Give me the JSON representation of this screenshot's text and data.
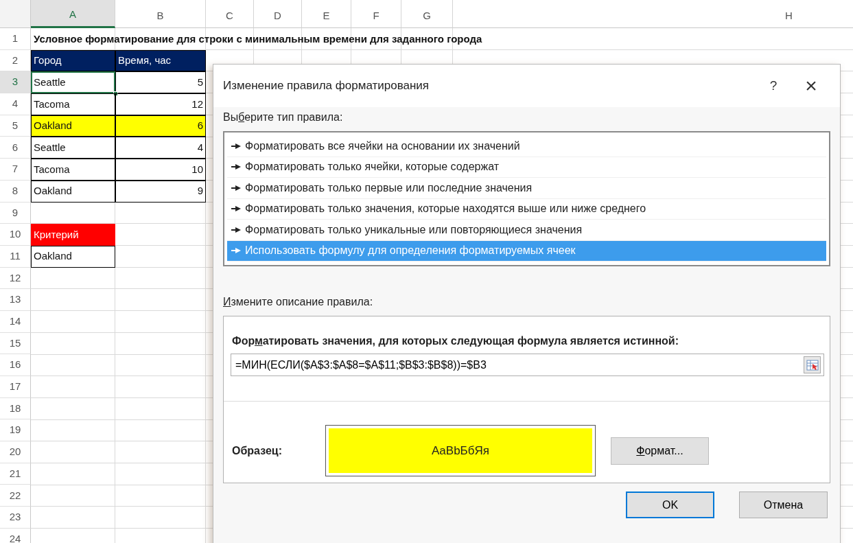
{
  "sheet": {
    "columns": [
      {
        "label": "A",
        "selected": true
      },
      {
        "label": "B",
        "selected": false
      },
      {
        "label": "C",
        "selected": false
      },
      {
        "label": "D",
        "selected": false
      },
      {
        "label": "E",
        "selected": false
      },
      {
        "label": "F",
        "selected": false
      },
      {
        "label": "G",
        "selected": false
      },
      {
        "label": "H",
        "selected": false
      }
    ],
    "rows": [
      {
        "label": "1",
        "selected": false,
        "cells": [
          {
            "kind": "title",
            "text": "Условное форматирование для строки с минимальным времени для заданного города"
          }
        ]
      },
      {
        "label": "2",
        "selected": false,
        "cells": [
          {
            "kind": "text",
            "text": "Город",
            "color": "#002060",
            "bordered": true,
            "selected": false
          },
          {
            "kind": "text",
            "text": "Время, час",
            "color": "#002060",
            "bordered": true,
            "selected": false
          }
        ]
      },
      {
        "label": "3",
        "selected": true,
        "cells": [
          {
            "kind": "text",
            "text": "Seattle",
            "bordered": true,
            "selected": true
          },
          {
            "kind": "number",
            "text": "5",
            "bordered": true,
            "selected": false
          }
        ]
      },
      {
        "label": "4",
        "selected": false,
        "cells": [
          {
            "kind": "text",
            "text": "Tacoma",
            "bordered": true,
            "selected": false
          },
          {
            "kind": "number",
            "text": "12",
            "bordered": true,
            "selected": false
          }
        ]
      },
      {
        "label": "5",
        "selected": false,
        "cells": [
          {
            "kind": "text",
            "text": "Oakland",
            "color": "#ffff00",
            "bordered": true,
            "selected": false
          },
          {
            "kind": "number",
            "text": "6",
            "color": "#ffff00",
            "bordered": true,
            "selected": false
          }
        ]
      },
      {
        "label": "6",
        "selected": false,
        "cells": [
          {
            "kind": "text",
            "text": "Seattle",
            "bordered": true,
            "selected": false
          },
          {
            "kind": "number",
            "text": "4",
            "bordered": true,
            "selected": false
          }
        ]
      },
      {
        "label": "7",
        "selected": false,
        "cells": [
          {
            "kind": "text",
            "text": "Tacoma",
            "bordered": true,
            "selected": false
          },
          {
            "kind": "number",
            "text": "10",
            "bordered": true,
            "selected": false
          }
        ]
      },
      {
        "label": "8",
        "selected": false,
        "cells": [
          {
            "kind": "text",
            "text": "Oakland",
            "bordered": true,
            "selected": false
          },
          {
            "kind": "number",
            "text": "9",
            "bordered": true,
            "selected": false
          }
        ]
      },
      {
        "label": "9",
        "selected": false
      },
      {
        "label": "10",
        "selected": false,
        "cells": [
          {
            "kind": "text",
            "text": "Критерий",
            "color": "#ff0000",
            "bordered": false,
            "selected": false
          }
        ]
      },
      {
        "label": "11",
        "selected": false,
        "cells": [
          {
            "kind": "text",
            "text": "Oakland",
            "bordered": true,
            "selected": false
          }
        ]
      },
      {
        "label": "12",
        "selected": false
      },
      {
        "label": "13",
        "selected": false
      },
      {
        "label": "14",
        "selected": false
      },
      {
        "label": "15",
        "selected": false
      },
      {
        "label": "16",
        "selected": false
      },
      {
        "label": "17",
        "selected": false
      },
      {
        "label": "18",
        "selected": false
      },
      {
        "label": "19",
        "selected": false
      },
      {
        "label": "20",
        "selected": false
      },
      {
        "label": "21",
        "selected": false
      },
      {
        "label": "22",
        "selected": false
      },
      {
        "label": "23",
        "selected": false
      },
      {
        "label": "24",
        "selected": false
      }
    ]
  },
  "dialog": {
    "title": "Изменение правила форматирования",
    "help": "?",
    "close": "×",
    "rule_type_label": {
      "before": "Вы",
      "key": "б",
      "after": "ерите тип правила:"
    },
    "rule_types": [
      {
        "label": "Форматировать все ячейки на основании их значений",
        "selected": false
      },
      {
        "label": "Форматировать только ячейки, которые содержат",
        "selected": false
      },
      {
        "label": "Форматировать только первые или последние значения",
        "selected": false
      },
      {
        "label": "Форматировать только значения, которые находятся выше или ниже среднего",
        "selected": false
      },
      {
        "label": "Форматировать только уникальные или повторяющиеся значения",
        "selected": false
      },
      {
        "label": "Использовать формулу для определения форматируемых ячеек",
        "selected": true
      }
    ],
    "description_label": {
      "key": "И",
      "after": "змените описание правила:"
    },
    "formula_label": {
      "before": "Фор",
      "key": "м",
      "after": "атировать значения, для которых следующая формула является истинной:"
    },
    "formula": "=МИН(ЕСЛИ($A$3:$A$8=$A$11;$B$3:$B$8))=$B3",
    "preview_label": "Образец:",
    "preview": {
      "text": "AaBbБбЯя",
      "color": "#ffff00"
    },
    "format_button": {
      "key": "Ф",
      "after": "ормат..."
    },
    "buttons": [
      {
        "label": "OK",
        "default": true
      },
      {
        "label": "Отмена",
        "default": false
      }
    ]
  }
}
